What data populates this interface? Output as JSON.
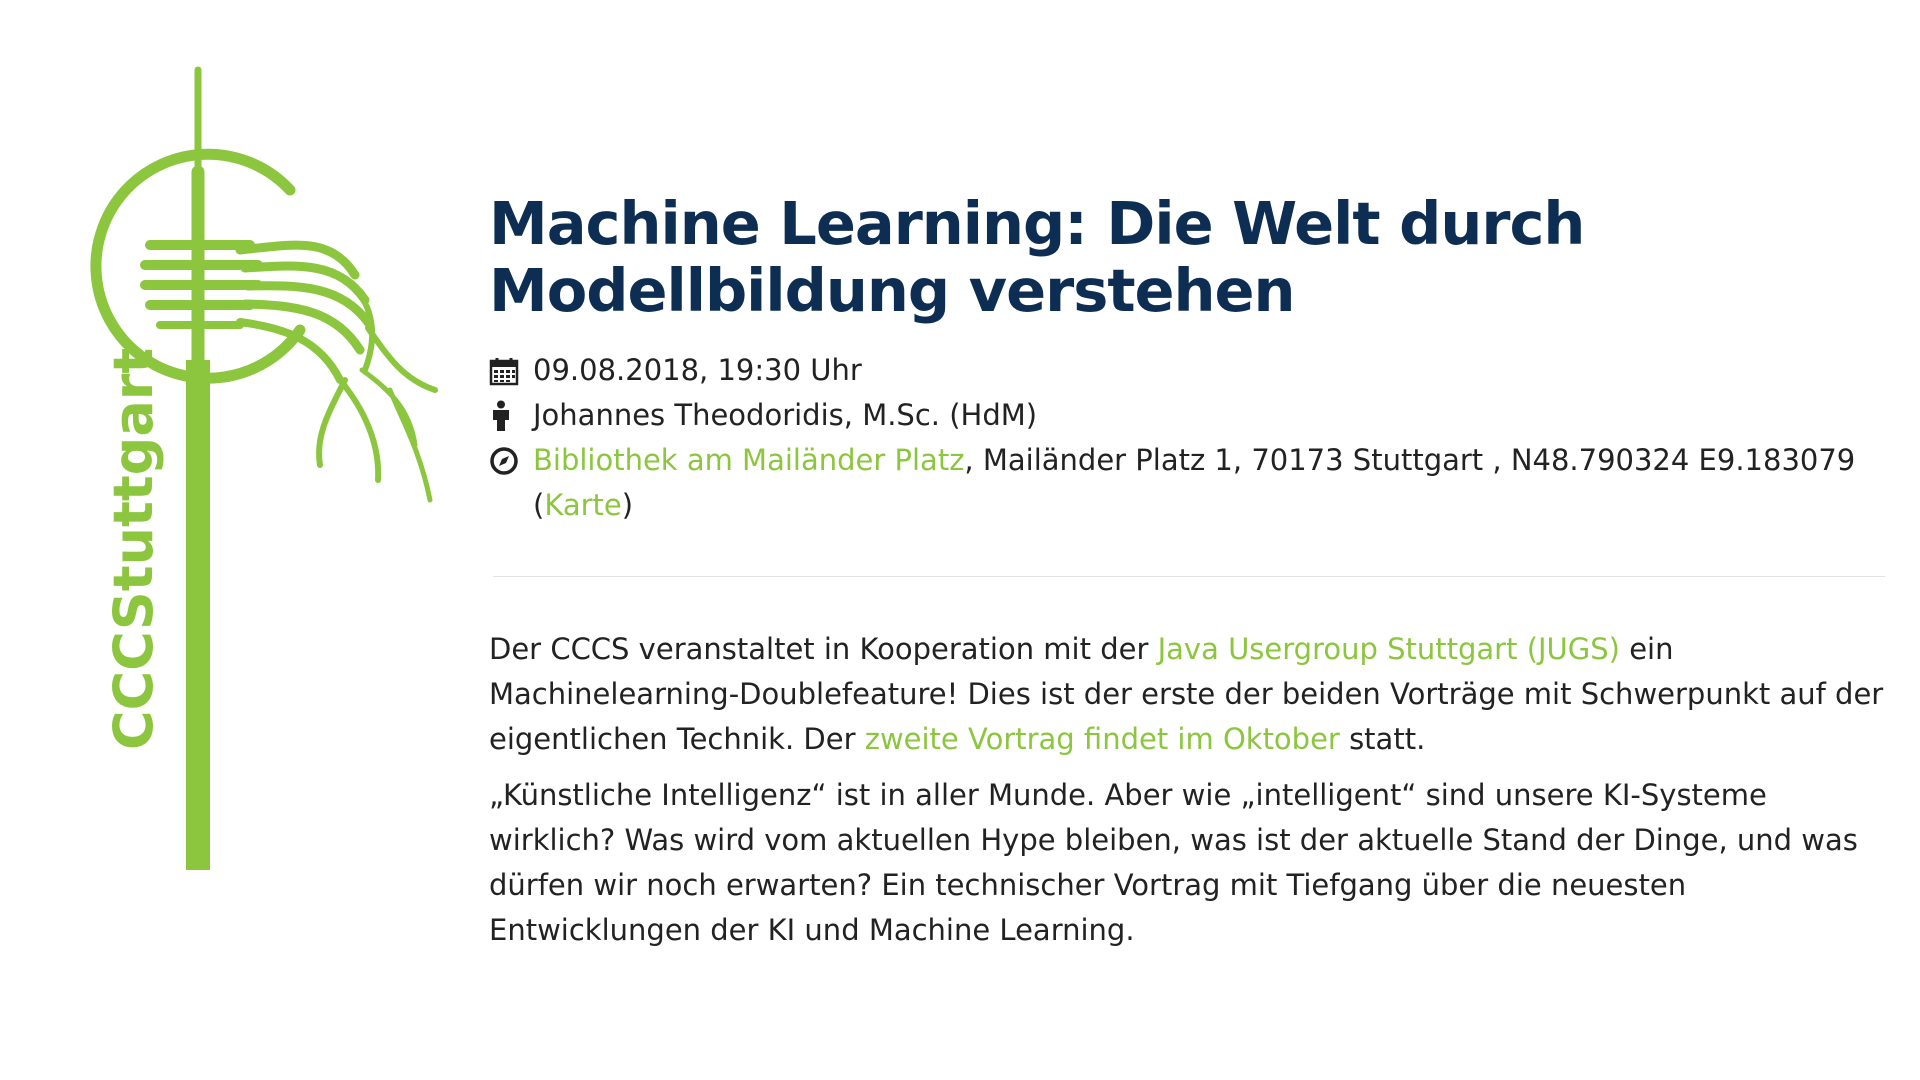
{
  "logo": {
    "text": "CCCStuttgart",
    "color": "#8cc63f"
  },
  "event": {
    "title": "Machine Learning: Die Welt durch Modellbildung verstehen",
    "date": "09.08.2018, 19:30 Uhr",
    "speaker": "Johannes Theodoridis, M.Sc. (HdM)",
    "location": {
      "venue_link": "Bibliothek am Mailänder Platz",
      "address": ", Mailänder Platz 1, 70173 Stuttgart , N48.790324 E9.183079",
      "map_open": "(",
      "map_link": "Karte",
      "map_close": ")"
    },
    "icons": {
      "date": "calendar-icon",
      "speaker": "person-icon",
      "location": "compass-icon"
    }
  },
  "description": {
    "p1": {
      "before": "Der CCCS veranstaltet in Kooperation mit der ",
      "link1": "Java Usergroup Stuttgart (JUGS)",
      "middle": " ein Machinelearning-Doublefeature! Dies ist der erste der beiden Vorträge mit Schwerpunkt auf der eigentlichen Technik. Der ",
      "link2": "zweite Vortrag findet im Oktober",
      "after": " statt."
    },
    "p2": "„Künstliche Intelligenz“ ist in aller Munde. Aber wie „intelligent“ sind unsere KI-Systeme wirklich? Was wird vom aktuellen Hype bleiben, was ist der aktuelle Stand der Dinge, und was dürfen wir noch erwarten? Ein technischer Vortrag mit Tiefgang über die neuesten Entwicklungen der KI und Machine Learning."
  },
  "colors": {
    "title": "#0d2e52",
    "link": "#8cc63f",
    "text": "#222222"
  }
}
